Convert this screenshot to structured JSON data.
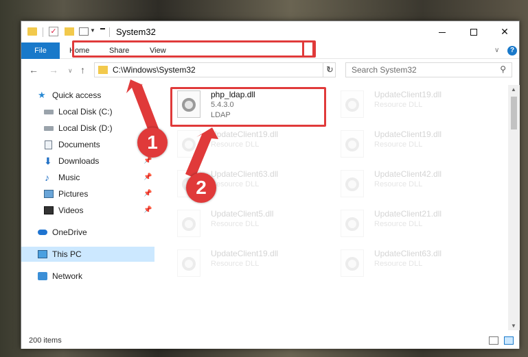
{
  "window": {
    "title": "System32",
    "close_glyph": "✕"
  },
  "ribbon": {
    "file": "File",
    "home": "Home",
    "share": "Share",
    "view": "View",
    "help": "?"
  },
  "nav": {
    "back": "←",
    "forward": "→",
    "up": "↑",
    "address": "C:\\Windows\\System32",
    "refresh": "↻",
    "search_placeholder": "Search System32"
  },
  "sidebar": {
    "items": [
      {
        "label": "Quick access",
        "icon": "star-icon"
      },
      {
        "label": "Local Disk (C:)",
        "icon": "drive-icon"
      },
      {
        "label": "Local Disk (D:)",
        "icon": "drive-icon"
      },
      {
        "label": "Documents",
        "icon": "documents-icon"
      },
      {
        "label": "Downloads",
        "icon": "downloads-icon",
        "pinned": true
      },
      {
        "label": "Music",
        "icon": "music-icon",
        "pinned": true
      },
      {
        "label": "Pictures",
        "icon": "pictures-icon",
        "pinned": true
      },
      {
        "label": "Videos",
        "icon": "videos-icon",
        "pinned": true
      },
      {
        "label": "OneDrive",
        "icon": "onedrive-icon"
      },
      {
        "label": "This PC",
        "icon": "this-pc-icon",
        "selected": true
      },
      {
        "label": "Network",
        "icon": "network-icon"
      }
    ]
  },
  "files": {
    "highlighted": {
      "name": "php_ldap.dll",
      "version": "5.4.3.0",
      "description": "LDAP"
    },
    "tiles": [
      {
        "name": "UpdateClient19.dll",
        "type": "Resource DLL"
      },
      {
        "name": "UpdateClient19.dll",
        "type": "Resource DLL"
      },
      {
        "name": "UpdateClient19.dll",
        "type": "Resource DLL"
      },
      {
        "name": "UpdateClient63.dll",
        "type": "Resource DLL"
      },
      {
        "name": "UpdateClient42.dll",
        "type": "Resource DLL"
      },
      {
        "name": "UpdateClient5.dll",
        "type": "Resource DLL"
      },
      {
        "name": "UpdateClient21.dll",
        "type": "Resource DLL"
      },
      {
        "name": "UpdateClient19.dll",
        "type": "Resource DLL"
      },
      {
        "name": "UpdateClient63.dll",
        "type": "Resource DLL"
      }
    ]
  },
  "status": {
    "item_count": "200 items"
  },
  "callouts": {
    "one": "1",
    "two": "2"
  },
  "colors": {
    "accent": "#1979ca",
    "highlight": "#e03a3a",
    "selection": "#cce8ff"
  }
}
